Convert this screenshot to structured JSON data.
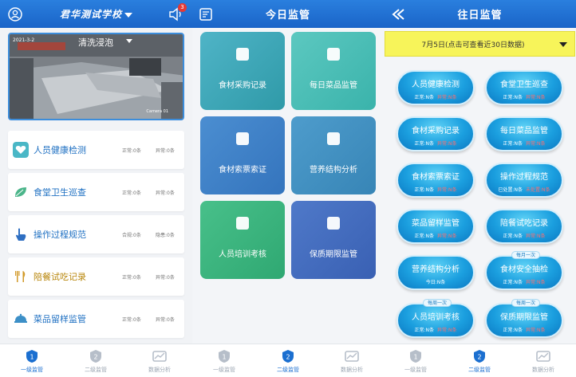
{
  "panel1": {
    "header": {
      "title": "君华测试学校",
      "badge": "3"
    },
    "camera": {
      "timestamp": "2021-3-2",
      "label": "清洗浸泡",
      "corner": "Camera 01"
    },
    "items": [
      {
        "label": "人员健康检测",
        "s1": "正常:0条",
        "s2": "异常:0条",
        "icon": "heart-pulse-icon",
        "color": "#4ab7c6"
      },
      {
        "label": "食堂卫生巡查",
        "s1": "正常:0条",
        "s2": "异常:0条",
        "icon": "leaf-icon",
        "color": "#4bb58a"
      },
      {
        "label": "操作过程规范",
        "s1": "合规:0条",
        "s2": "隐患:0条",
        "icon": "hand-pointer-icon",
        "color": "#2f6fc2"
      },
      {
        "label": "陪餐试吃记录",
        "s1": "正常:0条",
        "s2": "异常:0条",
        "icon": "utensils-icon",
        "color": "#d29a2a"
      },
      {
        "label": "菜品留样监管",
        "s1": "正常:0条",
        "s2": "异常:0条",
        "icon": "dish-cover-icon",
        "color": "#3c8fc7"
      }
    ],
    "tabs": [
      {
        "label": "一级监管",
        "num": "1"
      },
      {
        "label": "二级监管",
        "num": "2"
      },
      {
        "label": "数据分析"
      }
    ]
  },
  "panel2": {
    "header": {
      "title": "今日监管"
    },
    "tiles": [
      {
        "label": "食材采购记录",
        "icon": "clipboard-icon"
      },
      {
        "label": "每日菜品监管",
        "icon": "apple-icon"
      },
      {
        "label": "食材索票索证",
        "icon": "document-icon"
      },
      {
        "label": "营养结构分析",
        "icon": "layers-icon"
      },
      {
        "label": "人员培训考核",
        "icon": "training-icon"
      },
      {
        "label": "保质期限监管",
        "icon": "clock-icon"
      }
    ],
    "tabs": [
      {
        "label": "一级监管",
        "num": "1"
      },
      {
        "label": "二级监管",
        "num": "2"
      },
      {
        "label": "数据分析"
      }
    ]
  },
  "panel3": {
    "header": {
      "title": "往日监管"
    },
    "date_bar": "7月5日(点击可查看近30日数据)",
    "pills": [
      {
        "label": "人员健康检测",
        "ok": "正常:N条",
        "bad": "异常:N条"
      },
      {
        "label": "食堂卫生巡查",
        "ok": "正常:N条",
        "bad": "异常:N条"
      },
      {
        "label": "食材采购记录",
        "ok": "正常:N条",
        "bad": "异常:N条"
      },
      {
        "label": "每日菜品监管",
        "ok": "正常:N条",
        "bad": "异常:N条"
      },
      {
        "label": "食材索票索证",
        "ok": "正常:N条",
        "bad": "异常:N条"
      },
      {
        "label": "操作过程规范",
        "ok": "已处置:N条",
        "bad": "未处置:N条"
      },
      {
        "label": "菜品留样监管",
        "ok": "正常:N条",
        "bad": "异常:N条"
      },
      {
        "label": "陪餐试吃记录",
        "ok": "正常:N条",
        "bad": "异常:N条"
      },
      {
        "label": "营养结构分析",
        "ok": "今日:N条",
        "bad": ""
      },
      {
        "label": "食材安全抽检",
        "ok": "正常:N条",
        "bad": "异常:N条",
        "tag": "每月一次"
      },
      {
        "label": "人员培训考核",
        "ok": "正常:N条",
        "bad": "异常:N条",
        "tag": "每周一次"
      },
      {
        "label": "保质期限监管",
        "ok": "正常:N条",
        "bad": "异常:N条",
        "tag": "每周一次"
      }
    ],
    "tabs": [
      {
        "label": "一级监管",
        "num": "1"
      },
      {
        "label": "二级监管",
        "num": "2"
      },
      {
        "label": "数据分析"
      }
    ]
  },
  "colors": {
    "header": "#1f6fd3",
    "date_bar": "#f7f45a",
    "pill": "#1b9fdf",
    "warn": "#ff6e6e"
  }
}
